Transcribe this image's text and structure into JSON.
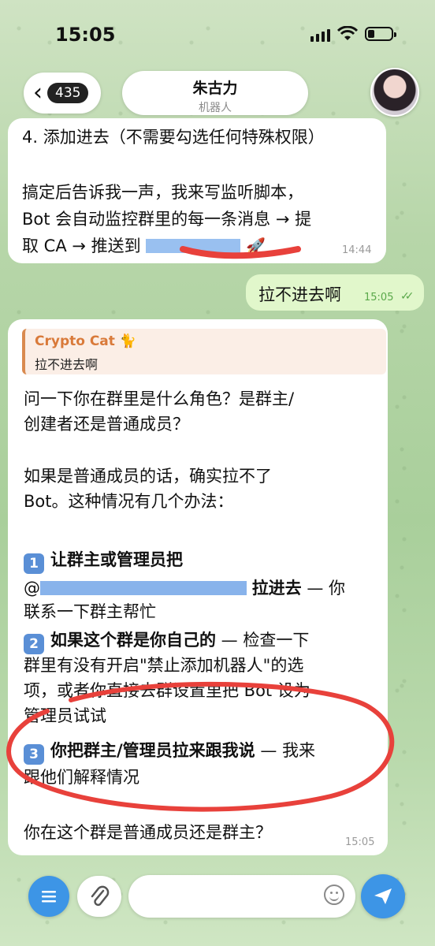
{
  "status_bar": {
    "time": "15:05"
  },
  "header": {
    "back_count": "435",
    "title": "朱古力",
    "subtitle": "机器人"
  },
  "messages": [
    {
      "id": "msg1",
      "lines": [
        "4. 添加进去（不需要勾选任何特殊权限）",
        "搞定后告诉我一声，我来写监听脚本，",
        "Bot 会自动监控群里的每一条消息 → 提",
        "取 CA → 推送到"
      ],
      "time": "14:44"
    },
    {
      "id": "msg2",
      "text": "拉不进去啊",
      "time": "15:05"
    },
    {
      "id": "msg3",
      "reply_to": {
        "name": "Crypto Cat 🐈",
        "text": "拉不进去啊"
      },
      "p1": [
        "问一下你在群里是什么角色？是群主/",
        "创建者还是普通成员？"
      ],
      "p2": [
        "如果是普通成员的话，确实拉不了",
        "Bot。这种情况有几个办法："
      ],
      "opt1": {
        "num": "1",
        "title": "让群主或管理员把",
        "line2_prefix": "@",
        "line2_bold": "拉进去",
        "line2_rest": " — 你",
        "line3": "联系一下群主帮忙"
      },
      "opt2": {
        "num": "2",
        "title": "如果这个群是你自己的",
        "rest": " — 检查一下",
        "line2": "群里有没有开启\"禁止添加机器人\"的选",
        "line3": "项，或者你直接去群设置里把 Bot 设为",
        "line4": "管理员试试"
      },
      "opt3": {
        "num": "3",
        "title": "你把群主/管理员拉来跟我说",
        "rest": " — 我来",
        "line2": "跟他们解释情况"
      },
      "question": "你在这个群是普通成员还是群主？",
      "time": "15:05"
    }
  ],
  "input": {
    "placeholder": ""
  }
}
